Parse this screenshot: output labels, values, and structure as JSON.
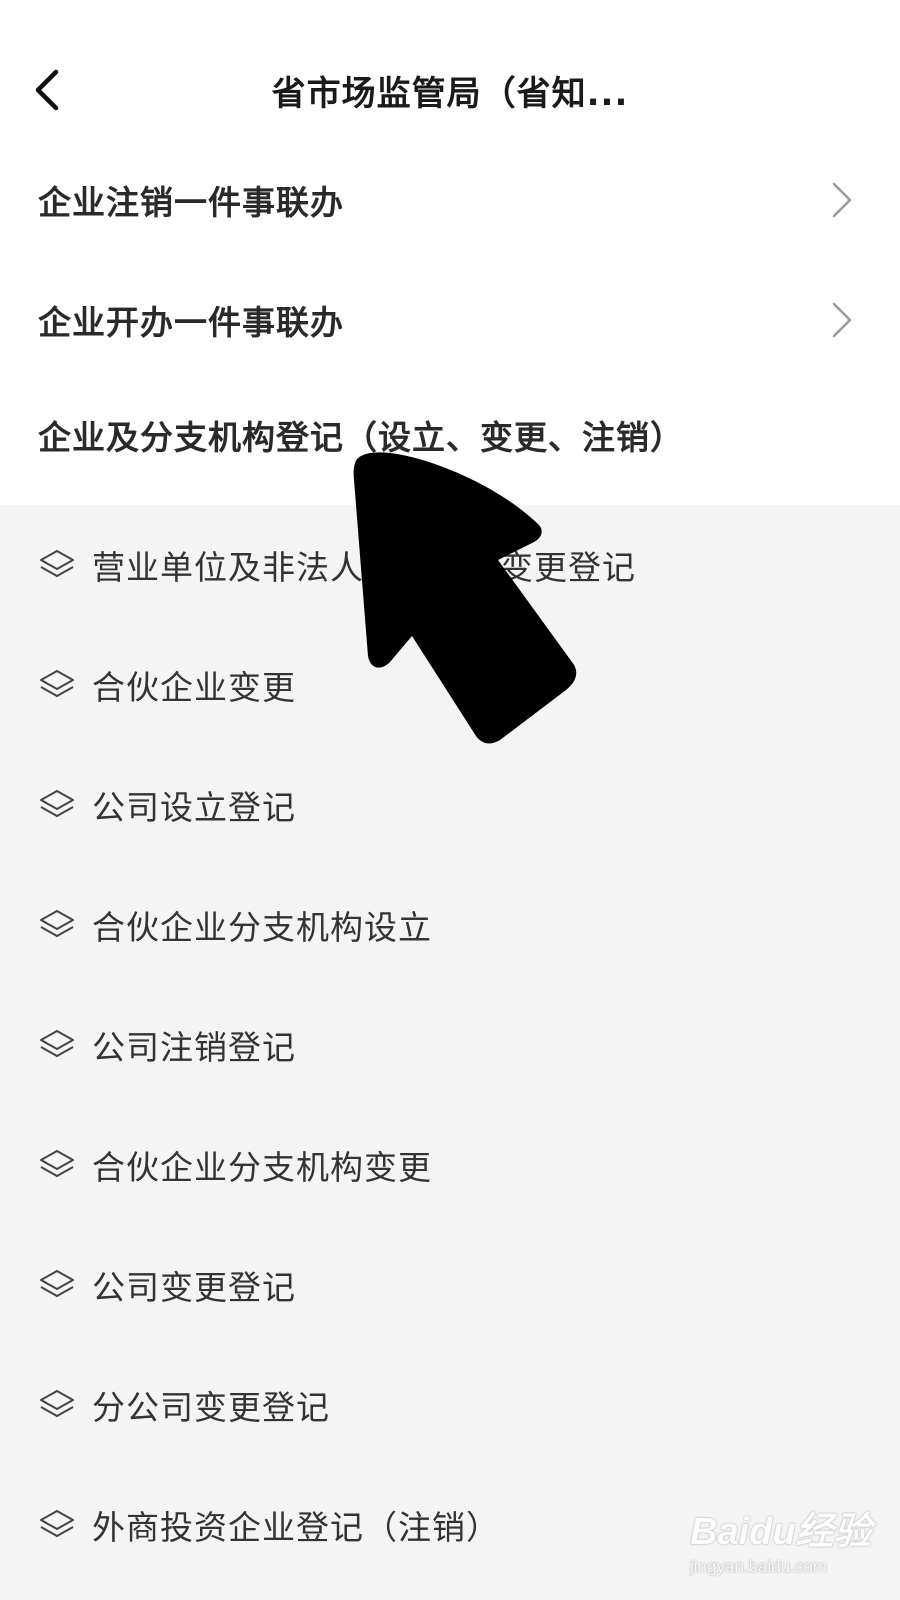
{
  "header": {
    "title": "省市场监管局（省知..."
  },
  "top_items": [
    {
      "label": "企业注销一件事联办",
      "has_chevron": true
    },
    {
      "label": "企业开办一件事联办",
      "has_chevron": true
    },
    {
      "label": "企业及分支机构登记（设立、变更、注销）",
      "has_chevron": false
    }
  ],
  "sub_items": [
    {
      "label": "营业单位及非法人分支机构变更登记",
      "icon": "layers-icon"
    },
    {
      "label": "合伙企业变更",
      "icon": "layers-icon"
    },
    {
      "label": "公司设立登记",
      "icon": "layers-icon"
    },
    {
      "label": "合伙企业分支机构设立",
      "icon": "layers-icon"
    },
    {
      "label": "公司注销登记",
      "icon": "layers-icon"
    },
    {
      "label": "合伙企业分支机构变更",
      "icon": "layers-icon"
    },
    {
      "label": "公司变更登记",
      "icon": "layers-icon"
    },
    {
      "label": "分公司变更登记",
      "icon": "layers-icon"
    },
    {
      "label": "外商投资企业登记（注销）",
      "icon": "layers-icon"
    }
  ],
  "watermark": {
    "main": "Baidu经验",
    "sub": "jingyan.baidu.com"
  },
  "colors": {
    "page_bg": "#f4f4f4",
    "section_bg": "#ffffff",
    "text_primary": "#222222",
    "chevron": "#9a9a9a",
    "cursor": "#000000"
  }
}
